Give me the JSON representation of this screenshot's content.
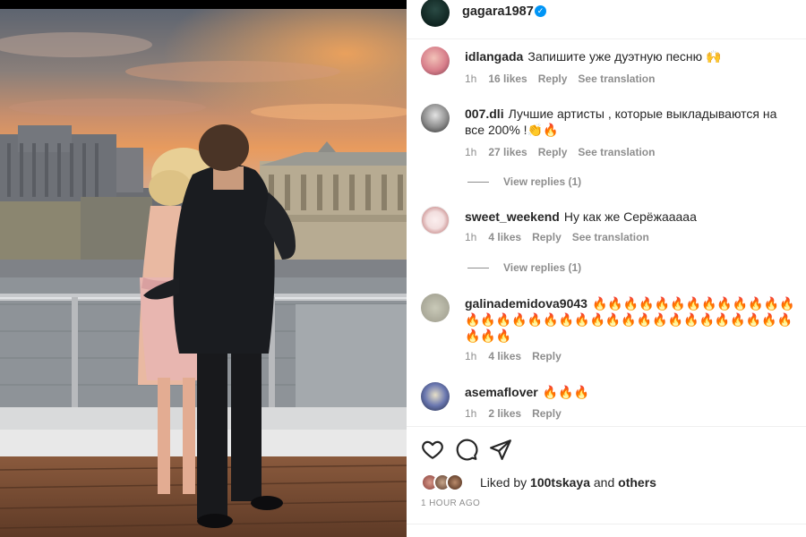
{
  "post": {
    "author": "gagara1987",
    "verified_mark": "✓",
    "image_description_icon": "photo"
  },
  "comments": [
    {
      "username": "idlangada",
      "text": "Запишите уже дуэтную песню 🙌",
      "time": "1h",
      "likes": "16 likes",
      "reply": "Reply",
      "translate": "See translation"
    },
    {
      "username": "007.dli",
      "text": "Лучшие артисты , которые выкладываются на все 200% !👏🔥",
      "time": "1h",
      "likes": "27 likes",
      "reply": "Reply",
      "translate": "See translation",
      "view_replies": "View replies (1)"
    },
    {
      "username": "sweet_weekend",
      "text": "Ну как же Серёжааааа",
      "time": "1h",
      "likes": "4 likes",
      "reply": "Reply",
      "translate": "See translation",
      "view_replies": "View replies (1)"
    },
    {
      "username": "galinademidova9043",
      "text": "🔥🔥🔥🔥🔥🔥🔥🔥🔥🔥🔥🔥🔥🔥🔥🔥🔥🔥🔥🔥🔥🔥🔥🔥🔥🔥🔥🔥🔥🔥🔥🔥🔥🔥🔥🔥🔥",
      "time": "1h",
      "likes": "4 likes",
      "reply": "Reply"
    },
    {
      "username": "asemaflover",
      "text": "🔥🔥🔥",
      "time": "1h",
      "likes": "2 likes",
      "reply": "Reply"
    }
  ],
  "actions": {
    "like_icon": "heart-icon",
    "comment_icon": "comment-icon",
    "share_icon": "send-icon"
  },
  "likes": {
    "prefix": "Liked by",
    "user": "100tskaya",
    "conj": "and",
    "others": "others"
  },
  "timestamp": "1 HOUR AGO",
  "colors": {
    "verified": "#0095f6",
    "muted": "#8e8e8e",
    "text": "#262626"
  }
}
